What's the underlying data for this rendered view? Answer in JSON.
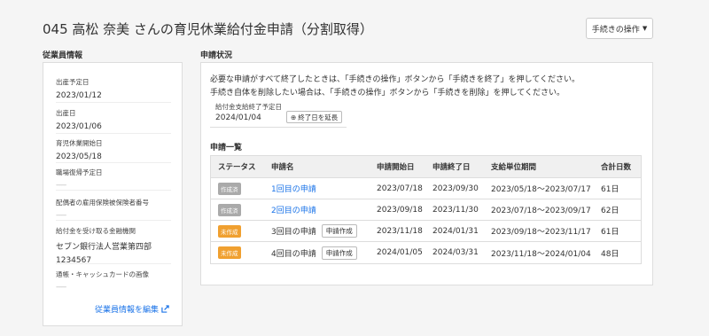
{
  "page": {
    "title": "045 高松 奈美 さんの育児休業給付金申請（分割取得）",
    "action_button": "手続きの操作"
  },
  "employee": {
    "section_label": "従業員情報",
    "fields": [
      {
        "label": "出産予定日",
        "value": "2023/01/12"
      },
      {
        "label": "出産日",
        "value": "2023/01/06"
      },
      {
        "label": "育児休業開始日",
        "value": "2023/05/18"
      },
      {
        "label": "職場復帰予定日",
        "value": "------"
      },
      {
        "label": "配偶者の雇用保険被保険者番号",
        "value": "------"
      },
      {
        "label": "給付金を受け取る金融機関",
        "value": "セブン銀行法人営業第四部",
        "value2": "1234567"
      },
      {
        "label": "通帳・キャッシュカードの画像",
        "value": "------"
      }
    ],
    "edit_link": "従業員情報を編集"
  },
  "application": {
    "section_label": "申請状況",
    "note1": "必要な申請がすべて終了したときは、「手続きの操作」ボタンから「手続きを終了」を押してください。",
    "note2": "手続き自体を削除したい場合は、「手続きの操作」ボタンから「手続きを削除」を押してください。",
    "pay_label": "給付金支給終了予定日",
    "pay_value": "2024/01/04",
    "extend_button": "終了日を延長",
    "list_title": "申請一覧",
    "headers": [
      "ステータス",
      "申請名",
      "申請開始日",
      "申請終了日",
      "支給単位期間",
      "合計日数"
    ],
    "rows": [
      {
        "status": "作成済",
        "name": "1回目の申請",
        "start": "2023/07/18",
        "end": "2023/09/30",
        "period": "2023/05/18〜2023/07/17",
        "days": "61日"
      },
      {
        "status": "作成済",
        "name": "2回目の申請",
        "start": "2023/09/18",
        "end": "2023/11/30",
        "period": "2023/07/18〜2023/09/17",
        "days": "62日"
      },
      {
        "status": "未作成",
        "name": "3回目の申請",
        "create": "申請作成",
        "start": "2023/11/18",
        "end": "2024/01/31",
        "period": "2023/09/18〜2023/11/17",
        "days": "61日"
      },
      {
        "status": "未作成",
        "name": "4回目の申請",
        "create": "申請作成",
        "start": "2024/01/05",
        "end": "2024/03/31",
        "period": "2023/11/18〜2024/01/04",
        "days": "48日"
      }
    ]
  },
  "colors": {
    "accent": "#1a73e8",
    "badge_done": "#aaaaaa",
    "badge_todo": "#f0a030"
  },
  "icons": {
    "caret": "caret-down-icon",
    "external": "external-link-icon",
    "plus": "plus-circle-icon"
  }
}
